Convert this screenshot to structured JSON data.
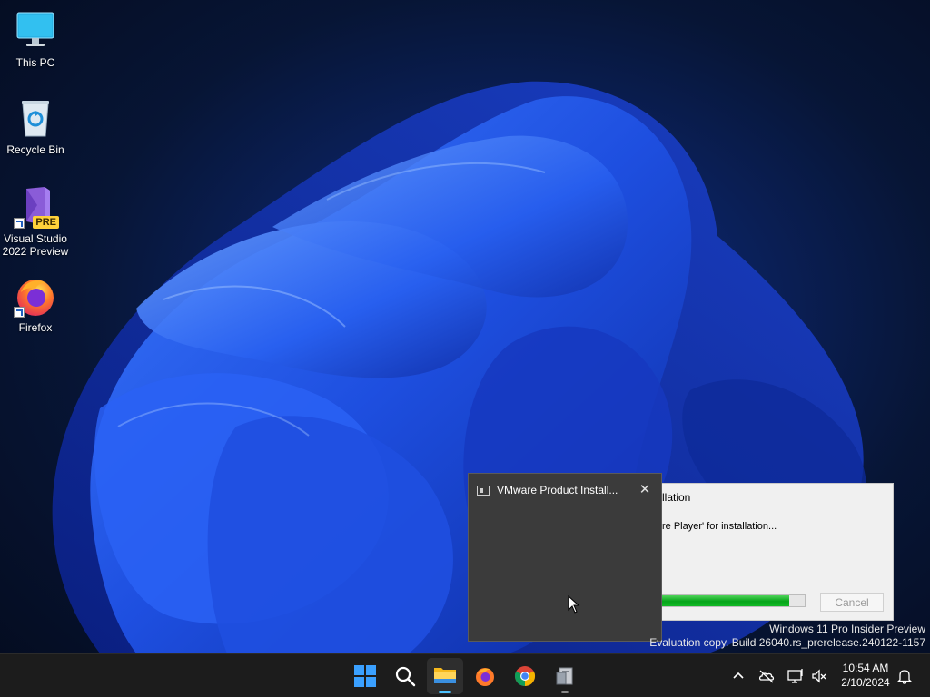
{
  "desktop": {
    "icons": [
      {
        "label": "This PC",
        "icon": "monitor-icon"
      },
      {
        "label": "Recycle Bin",
        "icon": "recycle-bin-icon"
      },
      {
        "label_line1": "Visual Studio",
        "label_line2": "2022 Preview",
        "badge": "PRE",
        "icon": "visual-studio-icon"
      },
      {
        "label": "Firefox",
        "icon": "firefox-icon"
      }
    ]
  },
  "install_dialog": {
    "title": "llation",
    "status": "re Player' for installation...",
    "progress": 0.9,
    "cancel_label": "Cancel"
  },
  "vm_popup": {
    "title": "VMware Product Install...",
    "close_label": "✕"
  },
  "watermark": {
    "line1": "Windows 11 Pro Insider Preview",
    "line2": "Evaluation copy. Build 26040.rs_prerelease.240122-1157"
  },
  "taskbar": {
    "apps": [
      "start-icon",
      "search-icon",
      "file-explorer-icon",
      "firefox-icon",
      "chrome-icon",
      "installer-icon"
    ],
    "clock_time": "10:54 AM",
    "clock_date": "2/10/2024"
  },
  "colors": {
    "accent": "#4cc2ff",
    "taskbar": "#1c1c1c",
    "progress_green": "#07a51a"
  }
}
